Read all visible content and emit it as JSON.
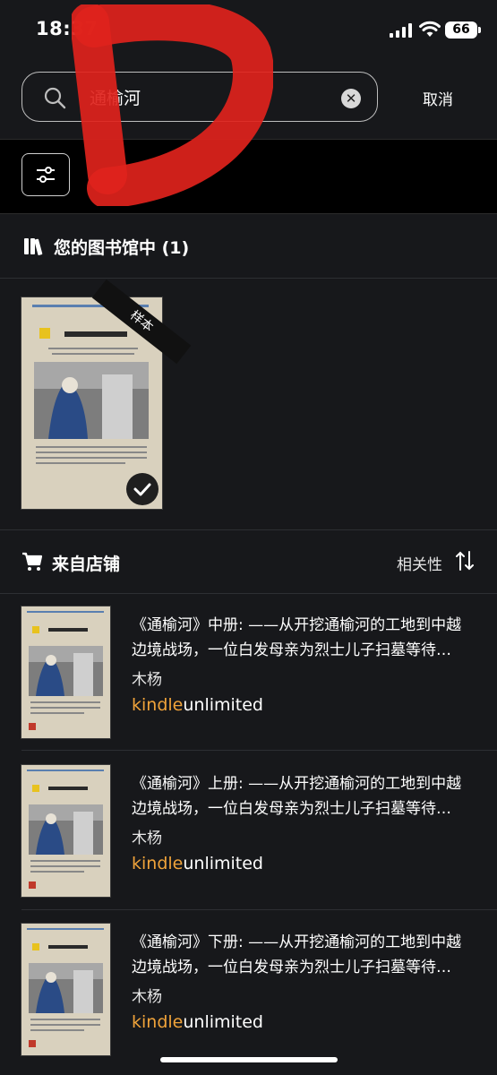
{
  "status_bar": {
    "time": "18:37",
    "battery": "66"
  },
  "search": {
    "query": "通榆河",
    "cancel_label": "取消"
  },
  "library": {
    "heading": "您的图书馆中 (1)",
    "book": {
      "ribbon": "样本"
    }
  },
  "store": {
    "heading": "来自店铺",
    "sort_label": "相关性",
    "results": [
      {
        "title": "《通榆河》中册: ——从开挖通榆河的工地到中越边境战场，一位白发母亲为烈士儿子扫墓等待…",
        "author": "木杨",
        "badge_kindle": "kindle",
        "badge_unlimited": "unlimited"
      },
      {
        "title": "《通榆河》上册: ——从开挖通榆河的工地到中越边境战场，一位白发母亲为烈士儿子扫墓等待…",
        "author": "木杨",
        "badge_kindle": "kindle",
        "badge_unlimited": "unlimited"
      },
      {
        "title": "《通榆河》下册: ——从开挖通榆河的工地到中越边境战场，一位白发母亲为烈士儿子扫墓等待…",
        "author": "木杨",
        "badge_kindle": "kindle",
        "badge_unlimited": "unlimited"
      }
    ]
  },
  "colors": {
    "background": "#17181b",
    "accent_kindle": "#f0a33a",
    "scribble": "#e0231c"
  }
}
